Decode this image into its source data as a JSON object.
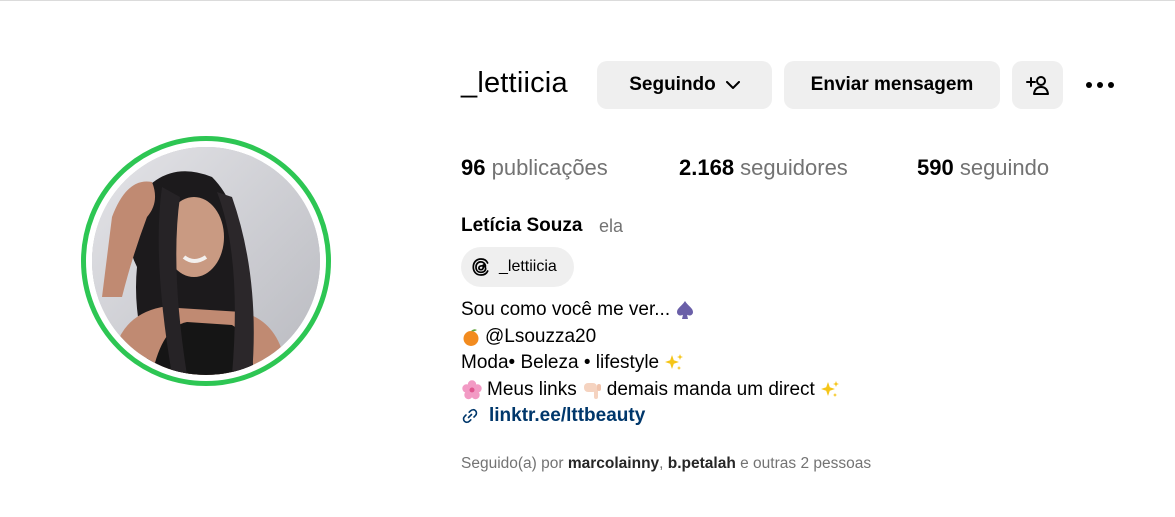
{
  "profile": {
    "username": "_lettiicia",
    "full_name": "Letícia Souza",
    "pronoun": "ela",
    "threads_handle": "_lettiicia",
    "bio_lines": [
      "Sou como você me ver... ",
      "@Lsouzza20",
      "Moda• Beleza • lifestyle ",
      "Meus links",
      " demais manda um direct"
    ],
    "link": "linktr.ee/lttbeauty"
  },
  "actions": {
    "following_label": "Seguindo",
    "message_label": "Enviar mensagem"
  },
  "stats": {
    "posts_count": "96",
    "posts_label": " publicações",
    "followers_count": "2.168",
    "followers_label": " seguidores",
    "following_count": "590",
    "following_label": " seguindo"
  },
  "followed_by": {
    "prefix": "Seguido(a) por ",
    "user1": "marcolainny",
    "separator": ", ",
    "user2": "b.petalah",
    "suffix": " e outras 2 pessoas"
  },
  "icons": {
    "dropdown": "chevron-down-icon",
    "add_user": "add-person-icon",
    "more": "more-options-icon",
    "threads": "threads-icon",
    "link": "link-icon"
  },
  "colors": {
    "story_ring": "#2dc653",
    "button_bg": "#efefef",
    "secondary_text": "#737373",
    "link": "#00376b"
  }
}
